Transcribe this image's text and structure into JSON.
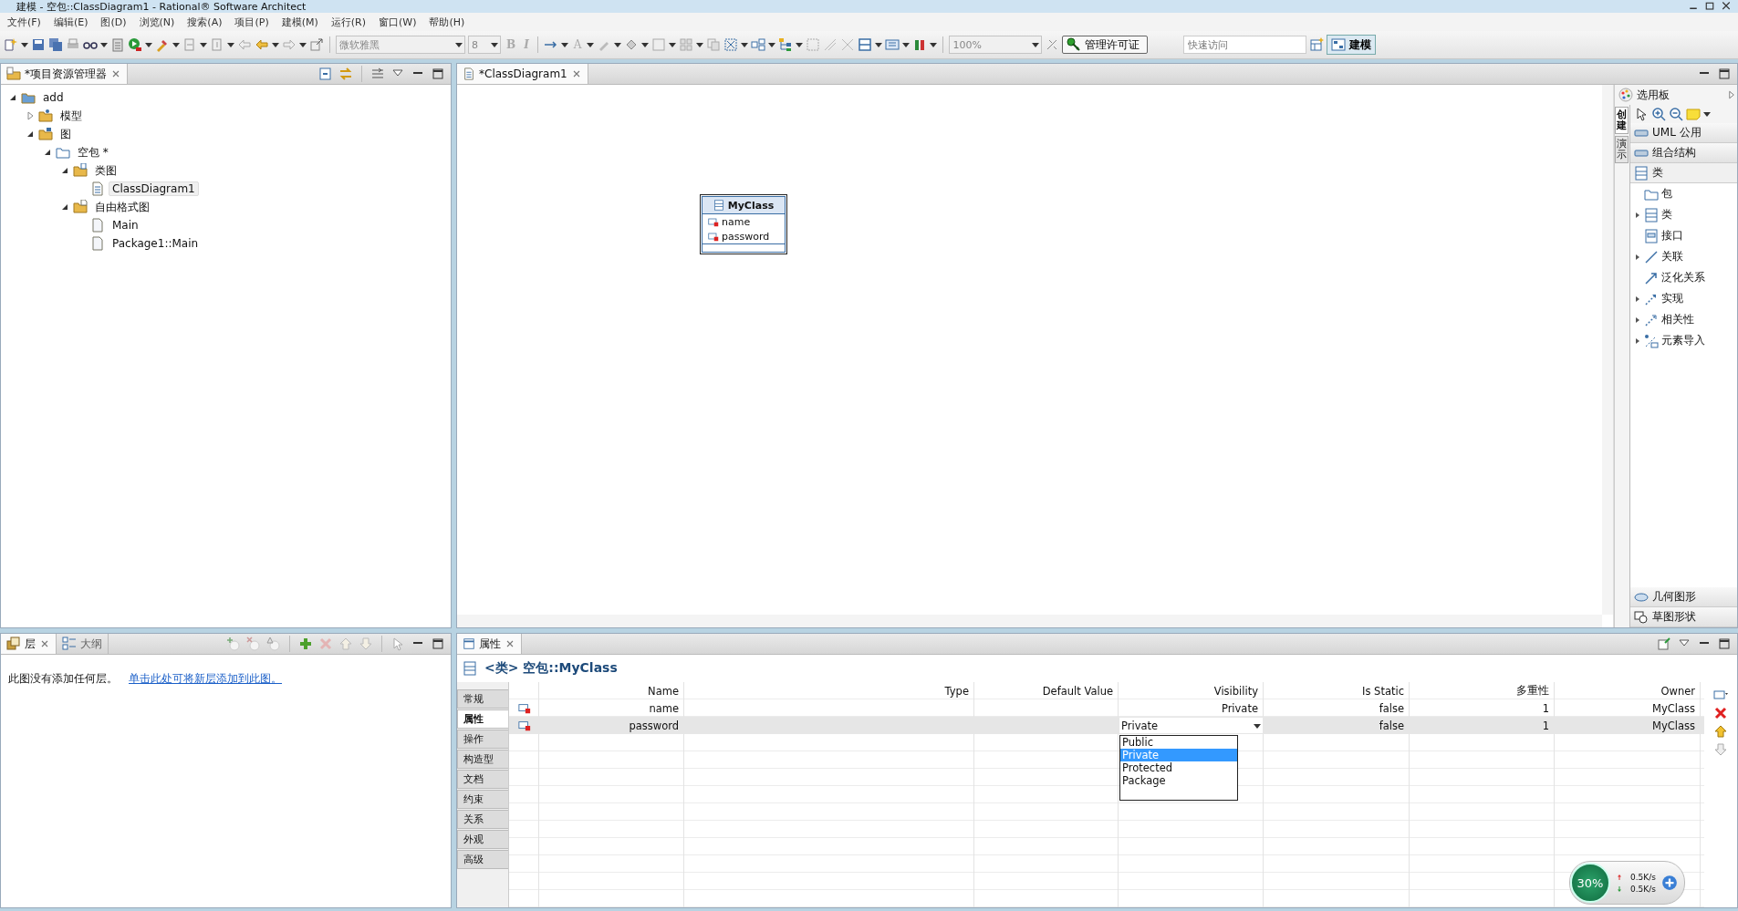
{
  "window": {
    "title": "建模 - 空包::ClassDiagram1 - Rational® Software Architect"
  },
  "menu": [
    "文件(F)",
    "编辑(E)",
    "图(D)",
    "浏览(N)",
    "搜索(A)",
    "项目(P)",
    "建模(M)",
    "运行(R)",
    "窗口(W)",
    "帮助(H)"
  ],
  "toolbar": {
    "font_field": "微软雅黑",
    "size_field": "8",
    "format_buttons": [
      "B",
      "I"
    ],
    "font_color": "A",
    "zoom_field": "100%",
    "license_button": "管理许可证",
    "quick_access": {
      "placeholder": "快速访问"
    },
    "perspective": {
      "label": "建模",
      "selected": true
    }
  },
  "explorer": {
    "tab": "*项目资源管理器",
    "tree": [
      {
        "label": "add",
        "kind": "project",
        "expanded": true,
        "selected": false,
        "children": [
          {
            "label": "模型",
            "kind": "models",
            "expanded": false,
            "selected": false
          },
          {
            "label": "图",
            "kind": "diagrams",
            "expanded": true,
            "selected": false,
            "children": [
              {
                "label": "空包 *",
                "kind": "package",
                "expanded": true,
                "selected": false,
                "children": [
                  {
                    "label": "类图",
                    "kind": "class-folder",
                    "expanded": true,
                    "selected": false,
                    "children": [
                      {
                        "label": "ClassDiagram1",
                        "kind": "diagram",
                        "selected": true
                      }
                    ]
                  },
                  {
                    "label": "自由格式图",
                    "kind": "free-folder",
                    "expanded": true,
                    "selected": false,
                    "children": [
                      {
                        "label": "Main",
                        "kind": "file",
                        "selected": false
                      },
                      {
                        "label": "Package1::Main",
                        "kind": "file",
                        "selected": false
                      }
                    ]
                  }
                ]
              }
            ]
          }
        ]
      }
    ]
  },
  "editor": {
    "tab": "*ClassDiagram1",
    "class_box": {
      "name": "MyClass",
      "attributes": [
        "name",
        "password"
      ]
    }
  },
  "palette": {
    "title": "选用板",
    "side_tabs": [
      {
        "label": "创建",
        "selected": true
      },
      {
        "label": "演示",
        "selected": false
      }
    ],
    "drawers": [
      {
        "label": "UML 公用",
        "expanded": false
      },
      {
        "label": "组合结构",
        "expanded": false
      },
      {
        "label": "类",
        "expanded": true
      }
    ],
    "items": [
      {
        "label": "包",
        "kind": "package",
        "expandable": false
      },
      {
        "label": "类",
        "kind": "class",
        "expandable": true
      },
      {
        "label": "接口",
        "kind": "interface",
        "expandable": false
      },
      {
        "label": "关联",
        "kind": "association",
        "expandable": true
      },
      {
        "label": "泛化关系",
        "kind": "generalization",
        "expandable": false
      },
      {
        "label": "实现",
        "kind": "realization",
        "expandable": true
      },
      {
        "label": "相关性",
        "kind": "dependency",
        "expandable": true
      },
      {
        "label": "元素导入",
        "kind": "import",
        "expandable": true
      }
    ],
    "bottom_drawers": [
      {
        "label": "几何图形",
        "kind": "geometry"
      },
      {
        "label": "草图形状",
        "kind": "sketch"
      }
    ]
  },
  "layers": {
    "tabs": [
      {
        "label": "层",
        "selected": true
      },
      {
        "label": "大纲",
        "selected": false
      }
    ],
    "message": "此图没有添加任何层。",
    "link": "单击此处可将新层添加到此图。"
  },
  "properties": {
    "tab": "属性",
    "heading": "<类> 空包::MyClass",
    "side_tabs": [
      {
        "label": "常规",
        "selected": false
      },
      {
        "label": "属性",
        "selected": true
      },
      {
        "label": "操作",
        "selected": false
      },
      {
        "label": "构造型",
        "selected": false
      },
      {
        "label": "文档",
        "selected": false
      },
      {
        "label": "约束",
        "selected": false
      },
      {
        "label": "关系",
        "selected": false
      },
      {
        "label": "外观",
        "selected": false
      },
      {
        "label": "高级",
        "selected": false
      }
    ],
    "columns": [
      "Name",
      "Type",
      "Default Value",
      "Visibility",
      "Is Static",
      "多重性",
      "Owner"
    ],
    "rows": [
      {
        "selected": false,
        "editing": false,
        "cells": [
          "name",
          "",
          "",
          "Private",
          "false",
          "1",
          "MyClass"
        ]
      },
      {
        "selected": true,
        "editing": true,
        "cells": [
          "password",
          "",
          "",
          "Private",
          "false",
          "1",
          "MyClass"
        ]
      }
    ],
    "dropdown": [
      {
        "label": "Public",
        "selected": false
      },
      {
        "label": "Private",
        "selected": true
      },
      {
        "label": "Protected",
        "selected": false
      },
      {
        "label": "Package",
        "selected": false
      }
    ]
  },
  "net_widget": {
    "percent": "30%",
    "upload": "0.5K/s",
    "download": "0.5K/s"
  }
}
